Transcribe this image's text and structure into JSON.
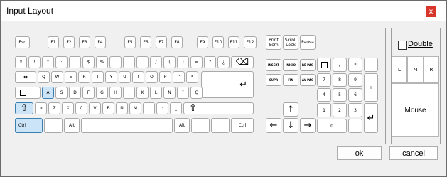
{
  "window": {
    "title": "Input Layout",
    "close_glyph": "x",
    "close_color": "#d9362b"
  },
  "colors": {
    "selected_key": "#cce4f7",
    "selected_border": "#3c7fb1"
  },
  "keyboard": {
    "fn_row": [
      "Esc",
      "F1",
      "F2",
      "F3",
      "F4",
      "F5",
      "F6",
      "F7",
      "F8",
      "F9",
      "F10",
      "F11",
      "F12"
    ],
    "sys_keys": {
      "print": "Print Scrn",
      "scroll": "Scroll Lock",
      "pause": "Pausa"
    },
    "row1": [
      "º",
      "!",
      "\"",
      "·",
      "$",
      "%",
      "/",
      "(",
      ")",
      "=",
      "?",
      "¿"
    ],
    "backspace_glyph": "⌫",
    "row2_tab_glyph": "⇔",
    "row2": [
      "Q",
      "W",
      "E",
      "R",
      "T",
      "Y",
      "U",
      "I",
      "O",
      "P",
      "^",
      "*"
    ],
    "enter_glyph": "↵",
    "row3_caps_icon": "caps-lock-icon",
    "row3": [
      "A",
      "S",
      "D",
      "F",
      "G",
      "H",
      "J",
      "K",
      "L",
      "Ñ",
      "¨",
      "Ç"
    ],
    "shift_glyph": "⇧",
    "row4": [
      ">",
      "Z",
      "X",
      "C",
      "V",
      "B",
      "N",
      "M",
      ";",
      ":",
      "_"
    ],
    "row5": {
      "ctrl_left": "Ctrl",
      "alt_left": "Alt",
      "alt_right": "Alt",
      "ctrl_right": "Ctrl"
    },
    "nav": {
      "insert": "INSERT",
      "inicio": "INICIO",
      "re_pag": "RE PAG",
      "supr": "SUPR",
      "fin": "FIN",
      "av_pag": "AV PAG"
    },
    "arrows": {
      "up": "↑",
      "left": "←",
      "down": "↓",
      "right": "→"
    },
    "numpad": {
      "num_icon": "numpad-icon",
      "row1": [
        "/",
        "*",
        "-"
      ],
      "row2": [
        "7",
        "8",
        "9"
      ],
      "plus": "+",
      "row3": [
        "4",
        "5",
        "6"
      ],
      "row4": [
        "1",
        "2",
        "3"
      ],
      "enter_glyph": "↵",
      "zero": "0",
      "dot": "."
    },
    "selected_key": "A"
  },
  "right_panel": {
    "double_label": "Double",
    "double_checked": false,
    "mouse_buttons": [
      "L",
      "M",
      "R"
    ],
    "mouse_label": "Mouse"
  },
  "footer": {
    "ok": "ok",
    "cancel": "cancel"
  }
}
